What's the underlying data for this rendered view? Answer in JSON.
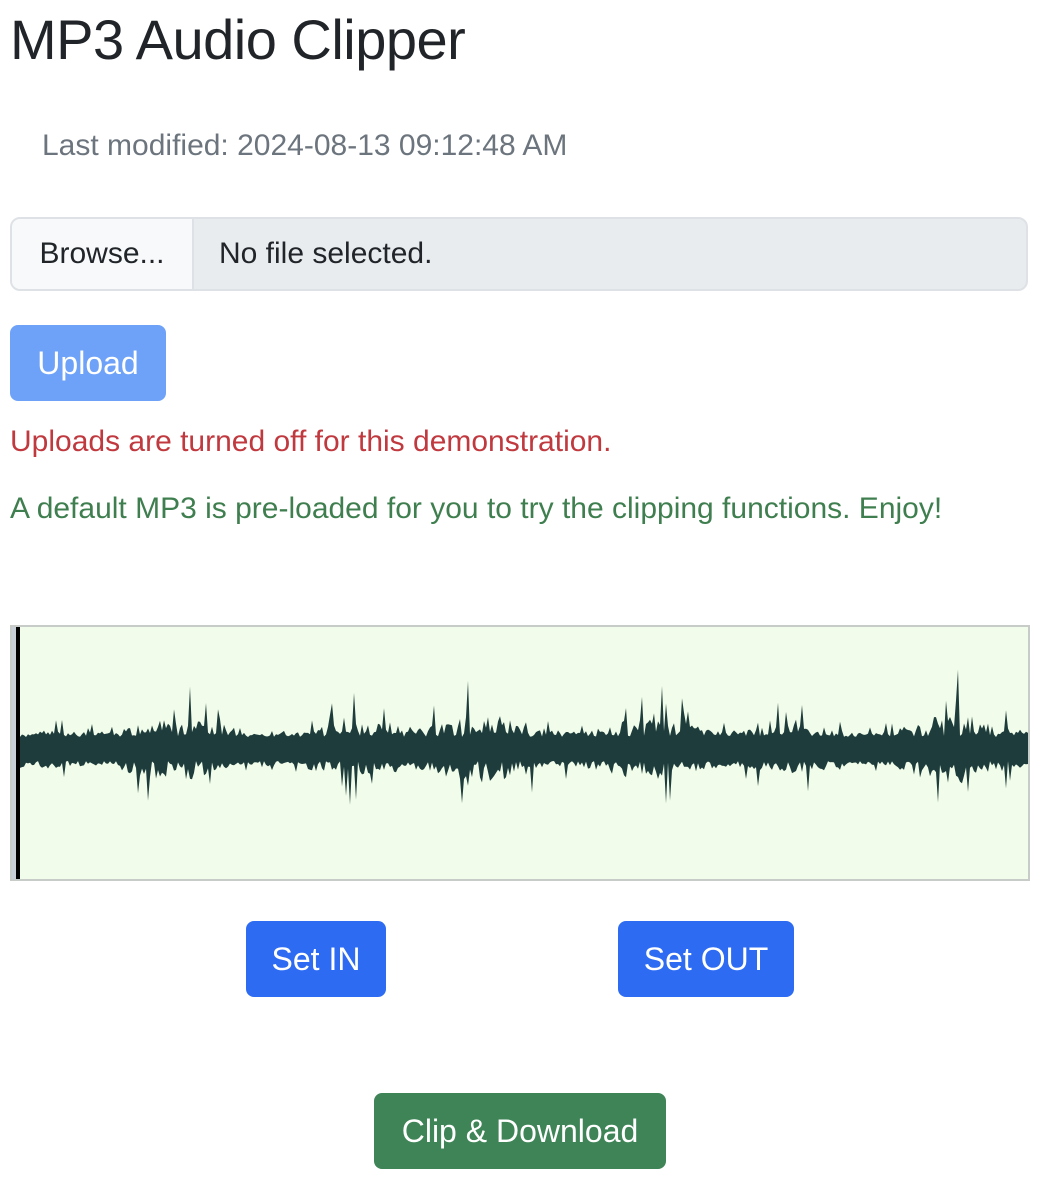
{
  "title": "MP3 Audio Clipper",
  "last_modified": "Last modified: 2024-08-13 09:12:48 AM",
  "file_input": {
    "browse_label": "Browse...",
    "status_text": "No file selected."
  },
  "upload_button": "Upload",
  "messages": {
    "error": "Uploads are turned off for this demonstration.",
    "info": "A default MP3 is pre-loaded for you to try the clipping functions. Enjoy!"
  },
  "waveform": {
    "playhead_position": 0.0,
    "colors": {
      "background": "#f1fdea",
      "wave": "#1e3c3c",
      "playhead": "#000000"
    }
  },
  "controls": {
    "set_in": "Set IN",
    "set_out": "Set OUT",
    "clip_download": "Clip & Download"
  },
  "colors": {
    "primary": "#2d6bf3",
    "primary_disabled": "#6ea2f8",
    "success": "#3e8457",
    "danger_text": "#c0393f",
    "success_text": "#3f7f4f"
  }
}
